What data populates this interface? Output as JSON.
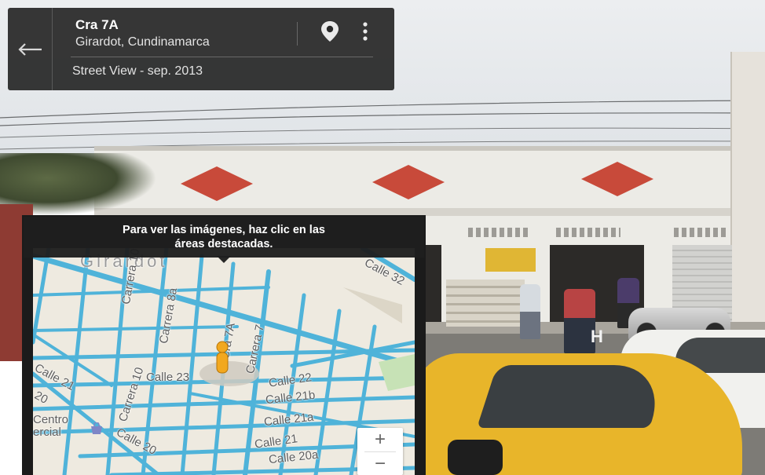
{
  "info_card": {
    "title": "Cra 7A",
    "subtitle": "Girardot, Cundinamarca",
    "imagery": "Street View - sep. 2013",
    "icons": {
      "back": "arrow-left-icon",
      "pin": "map-pin-icon",
      "more": "more-vert-icon"
    }
  },
  "tooltip": {
    "line1": "Para ver las imágenes, haz clic en las",
    "line2": "áreas destacadas."
  },
  "map": {
    "labels": {
      "city": "Girardot",
      "calle32": "Calle 32",
      "carrera10": "Carrera 10",
      "carrera8a": "Carrera 8a",
      "carrera7a": "Cra 7A",
      "carrera7": "Carrera 7",
      "calle23": "Calle 23",
      "calle22": "Calle 22",
      "calle21b": "Calle 21b",
      "calle21a": "Calle 21a",
      "calle21": "Calle 21",
      "calle21_left": "Calle 21",
      "calle20_left": "20",
      "calle20": "Calle 20",
      "calle20a": "Calle 20a",
      "carrera10_lower": "Carrera 10",
      "centro1": "Centro",
      "centro2": "ercial"
    },
    "zoom_in": "+",
    "zoom_out": "−",
    "road_color": "#4fb3d9"
  },
  "scene": {
    "sign_text": "",
    "sidewalk_mark": "H"
  }
}
